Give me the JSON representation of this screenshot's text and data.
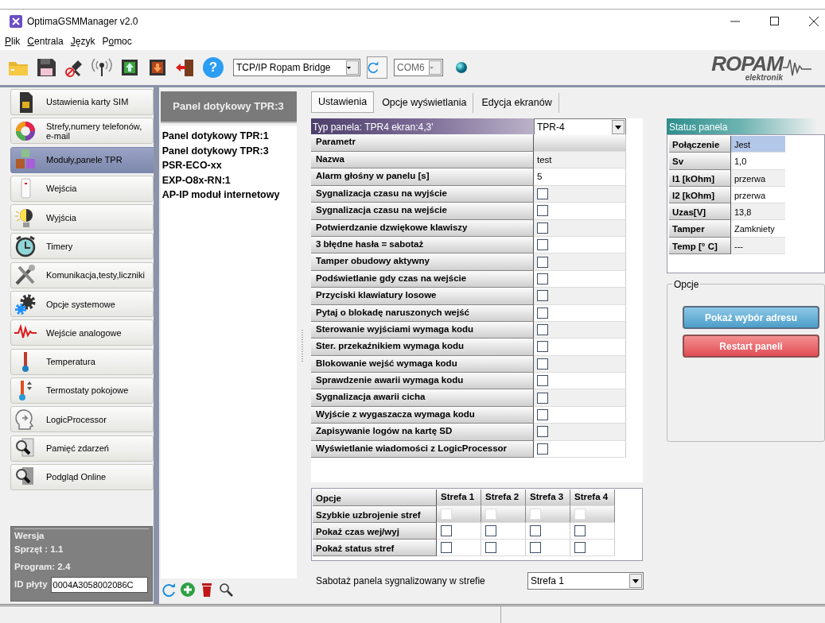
{
  "window": {
    "title": "OptimaGSMManager v2.0"
  },
  "menu": [
    {
      "key": "P",
      "post": "lik"
    },
    {
      "key": "C",
      "post": "entrala"
    },
    {
      "key": "J",
      "post": "ęzyk"
    },
    {
      "pre": "P",
      "key": "o",
      "post": "moc"
    }
  ],
  "toolbar": {
    "help_glyph": "?",
    "connection": "TCP/IP Ropam Bridge",
    "port": "COM6",
    "port_disabled": true,
    "logo": "ROPAM",
    "logo_sub": "elektronik"
  },
  "sidebar": {
    "items": [
      {
        "label": "Ustawienia karty SIM",
        "selected": false
      },
      {
        "label": "Strefy,numery telefonów, e-mail",
        "selected": false
      },
      {
        "label": "Moduły,panele TPR",
        "selected": true
      },
      {
        "label": "Wejścia",
        "selected": false
      },
      {
        "label": "Wyjścia",
        "selected": false
      },
      {
        "label": "Timery",
        "selected": false
      },
      {
        "label": "Komunikacja,testy,liczniki",
        "selected": false
      },
      {
        "label": "Opcje systemowe",
        "selected": false
      },
      {
        "label": "Wejście analogowe",
        "selected": false
      },
      {
        "label": "Temperatura",
        "selected": false
      },
      {
        "label": "Termostaty pokojowe",
        "selected": false
      },
      {
        "label": "LogicProcessor",
        "selected": false
      },
      {
        "label": "Pamięć zdarzeń",
        "selected": false
      },
      {
        "label": "Podgląd Online",
        "selected": false
      }
    ],
    "version": {
      "title": "Wersja",
      "hardware": "Sprzęt : 1.1",
      "program": "Program: 2.4",
      "id_label": "ID płyty",
      "id_value": "0004A3058002086C"
    }
  },
  "modules": {
    "header": "Panel dotykowy TPR:3",
    "items": [
      "Panel dotykowy TPR:1",
      "Panel dotykowy TPR:3",
      "PSR-ECO-xx",
      "EXP-O8x-RN:1",
      "AP-IP moduł internetowy"
    ]
  },
  "tabs": [
    {
      "label": "Ustawienia",
      "selected": true
    },
    {
      "label": "Opcje wyświetlania",
      "selected": false
    },
    {
      "label": "Edycja  ekranów",
      "selected": false
    }
  ],
  "panel_type": {
    "label": "Typ panela: TPR4 ekran:4,3'",
    "value": "TPR-4"
  },
  "params": {
    "header": "Parametr",
    "rows": [
      {
        "kind": "text",
        "label": "Nazwa",
        "value": "test"
      },
      {
        "kind": "text",
        "label": "Alarm głośny w panelu [s]",
        "value": "5"
      },
      {
        "kind": "checkbox",
        "label": "Sygnalizacja czasu na wyjście",
        "checked": false
      },
      {
        "kind": "checkbox",
        "label": "Sygnalizacja czasu na wejście",
        "checked": false
      },
      {
        "kind": "checkbox",
        "label": "Potwierdzanie dzwiękowe klawiszy",
        "checked": false
      },
      {
        "kind": "checkbox",
        "label": "3 błędne hasła = sabotaż",
        "checked": false
      },
      {
        "kind": "checkbox",
        "label": "Tamper obudowy aktywny",
        "checked": false
      },
      {
        "kind": "checkbox",
        "label": "Podświetlanie gdy czas na wejście",
        "checked": false
      },
      {
        "kind": "checkbox",
        "label": "Przyciski klawiatury losowe",
        "checked": false
      },
      {
        "kind": "checkbox",
        "label": "Pytaj o blokadę naruszonych wejść",
        "checked": false
      },
      {
        "kind": "checkbox",
        "label": "Sterowanie wyjściami wymaga kodu",
        "checked": false
      },
      {
        "kind": "checkbox",
        "label": "Ster. przekaźnikiem wymaga kodu",
        "checked": false
      },
      {
        "kind": "checkbox",
        "label": "Blokowanie wejść wymaga kodu",
        "checked": false
      },
      {
        "kind": "checkbox",
        "label": "Sprawdzenie awarii wymaga kodu",
        "checked": false
      },
      {
        "kind": "checkbox",
        "label": "Sygnalizacja awarii cicha",
        "checked": false
      },
      {
        "kind": "checkbox",
        "label": "Wyjście z wygaszacza wymaga kodu",
        "checked": false
      },
      {
        "kind": "checkbox",
        "label": "Zapisywanie  logów na  kartę SD",
        "checked": false
      },
      {
        "kind": "checkbox",
        "label": "Wyświetlanie wiadomości z LogicProcessor",
        "checked": false
      }
    ]
  },
  "status": {
    "title": "Status panela",
    "rows": [
      {
        "label": "Połączenie",
        "value": "Jest",
        "selected": true
      },
      {
        "label": "Sv",
        "value": "1,0",
        "selected": false
      },
      {
        "label": "I1 [kOhm]",
        "value": "przerwa",
        "selected": false
      },
      {
        "label": "I2 [kOhm]",
        "value": "przerwa",
        "selected": false
      },
      {
        "label": "Uzas[V]",
        "value": "13,8",
        "selected": false
      },
      {
        "label": "Tamper",
        "value": "Zamkniety",
        "selected": false
      },
      {
        "label": "Temp [° C]",
        "value": "---",
        "selected": false
      }
    ]
  },
  "options": {
    "title": "Opcje",
    "buttons": [
      {
        "label": "Pokaż wybór adresu",
        "kind": "info"
      },
      {
        "label": "Restart  paneli",
        "kind": "danger"
      }
    ]
  },
  "zones": {
    "columns": [
      "Opcje",
      "Strefa 1",
      "Strefa 2",
      "Strefa 3",
      "Strefa 4"
    ],
    "rows": [
      {
        "label": "Szybkie uzbrojenie stref",
        "cells": [
          {
            "checked": false,
            "disabled": true
          },
          {
            "checked": false,
            "disabled": true
          },
          {
            "checked": false,
            "disabled": true
          },
          {
            "checked": false,
            "disabled": true
          }
        ]
      },
      {
        "label": "Pokaż czas wej/wyj",
        "cells": [
          {
            "checked": false,
            "disabled": false
          },
          {
            "checked": false,
            "disabled": false
          },
          {
            "checked": false,
            "disabled": false
          },
          {
            "checked": false,
            "disabled": false
          }
        ]
      },
      {
        "label": "Pokaż status stref",
        "cells": [
          {
            "checked": false,
            "disabled": false
          },
          {
            "checked": false,
            "disabled": false
          },
          {
            "checked": false,
            "disabled": false
          },
          {
            "checked": false,
            "disabled": false
          }
        ]
      }
    ]
  },
  "tamper_zone": {
    "label": "Sabotaż panela sygnalizowany w strefie",
    "value": "Strefa 1"
  }
}
